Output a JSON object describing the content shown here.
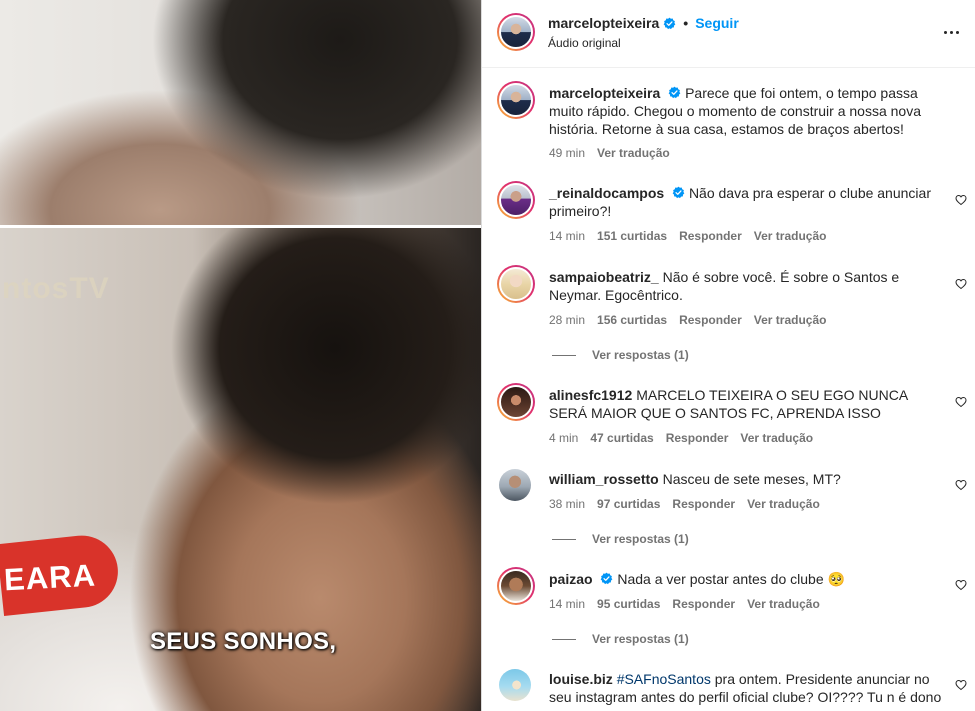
{
  "media": {
    "watermark": "ntosTV",
    "sponsor": "EARA",
    "caption": "SEUS SONHOS,"
  },
  "post": {
    "author": "marcelopteixeira",
    "separator": "•",
    "follow_label": "Seguir",
    "audio_label": "Áudio original",
    "more_icon": "more-horizontal-icon"
  },
  "caption_comment": {
    "user": "marcelopteixeira",
    "text": "Parece que foi ontem, o tempo passa muito rápido. Chegou o momento de construir a nossa nova história. Retorne à sua casa, estamos de braços abertos!",
    "time": "49 min",
    "translate": "Ver tradução"
  },
  "comments": [
    {
      "user": "_reinaldocampos",
      "text": "Não dava pra esperar o clube anunciar primeiro?!",
      "time": "14 min",
      "likes": "151 curtidas",
      "reply": "Responder",
      "translate": "Ver tradução"
    },
    {
      "user": "sampaiobeatriz_",
      "text": "Não é sobre você. É sobre o Santos e Neymar. Egocêntrico.",
      "time": "28 min",
      "likes": "156 curtidas",
      "reply": "Responder",
      "translate": "Ver tradução",
      "replies": "Ver respostas (1)"
    },
    {
      "user": "alinesfc1912",
      "text": "MARCELO TEIXEIRA O SEU EGO NUNCA SERÁ MAIOR QUE O SANTOS FC, APRENDA ISSO",
      "time": "4 min",
      "likes": "47 curtidas",
      "reply": "Responder",
      "translate": "Ver tradução"
    },
    {
      "user": "william_rossetto",
      "text": "Nasceu de sete meses, MT?",
      "time": "38 min",
      "likes": "97 curtidas",
      "reply": "Responder",
      "translate": "Ver tradução",
      "replies": "Ver respostas (1)"
    },
    {
      "user": "paizao",
      "text": "Nada a ver postar antes do clube 🥺",
      "time": "14 min",
      "likes": "95 curtidas",
      "reply": "Responder",
      "translate": "Ver tradução",
      "replies": "Ver respostas (1)"
    },
    {
      "user": "louise.biz",
      "hashtag": "#SAFnoSantos",
      "text": "pra ontem. Presidente anunciar no seu instagram antes do perfil oficial clube? OI???? Tu n é dono"
    }
  ],
  "colors": {
    "link": "#0095f6",
    "verified": "#0095f6",
    "hashtag": "#00376b",
    "muted": "#737373"
  }
}
